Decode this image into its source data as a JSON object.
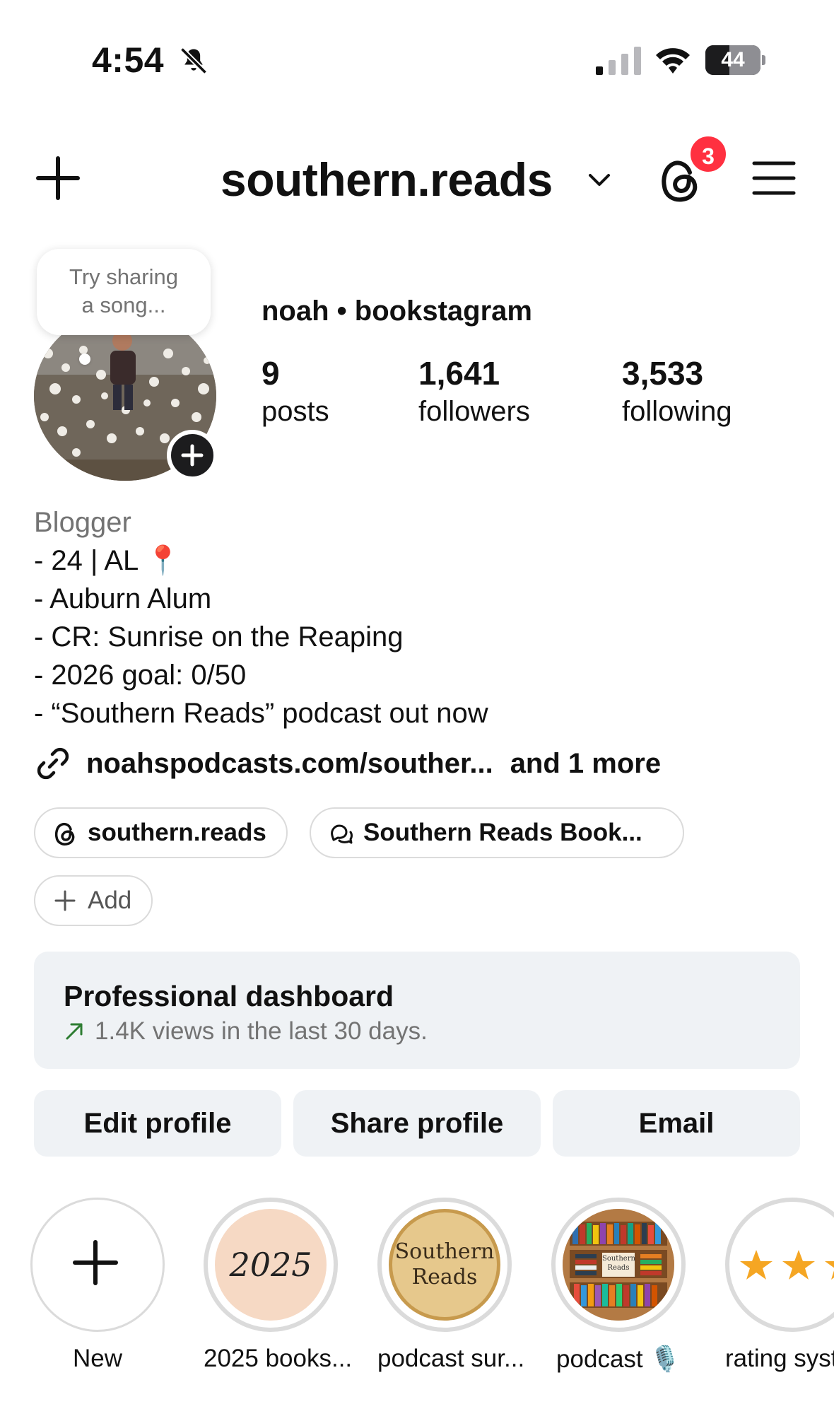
{
  "status_bar": {
    "time": "4:54",
    "battery": "44",
    "battery_level": 0.44
  },
  "header": {
    "username": "southern.reads",
    "notification_count": "3"
  },
  "profile": {
    "note_prompt_line1": "Try sharing",
    "note_prompt_line2": "a song...",
    "display_name": "noah • bookstagram",
    "stats": [
      {
        "value": "9",
        "label": "posts"
      },
      {
        "value": "1,641",
        "label": "followers"
      },
      {
        "value": "3,533",
        "label": "following"
      }
    ],
    "bio_category": "Blogger",
    "bio_lines": [
      "- 24 | AL 📍",
      "- Auburn Alum",
      "- CR: Sunrise on the Reaping",
      "- 2026 goal: 0/50",
      "- “Southern Reads” podcast out now"
    ],
    "link_text": "noahspodcasts.com/souther...",
    "link_more": "and 1 more"
  },
  "chips": {
    "threads": "southern.reads",
    "channel": "Southern Reads Book...",
    "add": "Add"
  },
  "dashboard": {
    "title": "Professional dashboard",
    "subtitle": "1.4K views in the last 30 days.",
    "trend_color": "#2e7d32"
  },
  "actions": {
    "edit": "Edit profile",
    "share": "Share profile",
    "email": "Email"
  },
  "highlights": [
    {
      "label": "New",
      "cover_text": ""
    },
    {
      "label": "2025 books...",
      "cover_text": "2025"
    },
    {
      "label": "podcast sur...",
      "cover_text_line1": "Southern",
      "cover_text_line2": "Reads"
    },
    {
      "label": "podcast 🎙️",
      "cover_text_line1": "Southern",
      "cover_text_line2": "Reads"
    },
    {
      "label": "rating syst",
      "cover_text": ""
    }
  ],
  "colors": {
    "badge": "#ff3040",
    "chip_border": "#dbdbdb",
    "button_bg": "#eff2f5",
    "muted_text": "#737373"
  }
}
